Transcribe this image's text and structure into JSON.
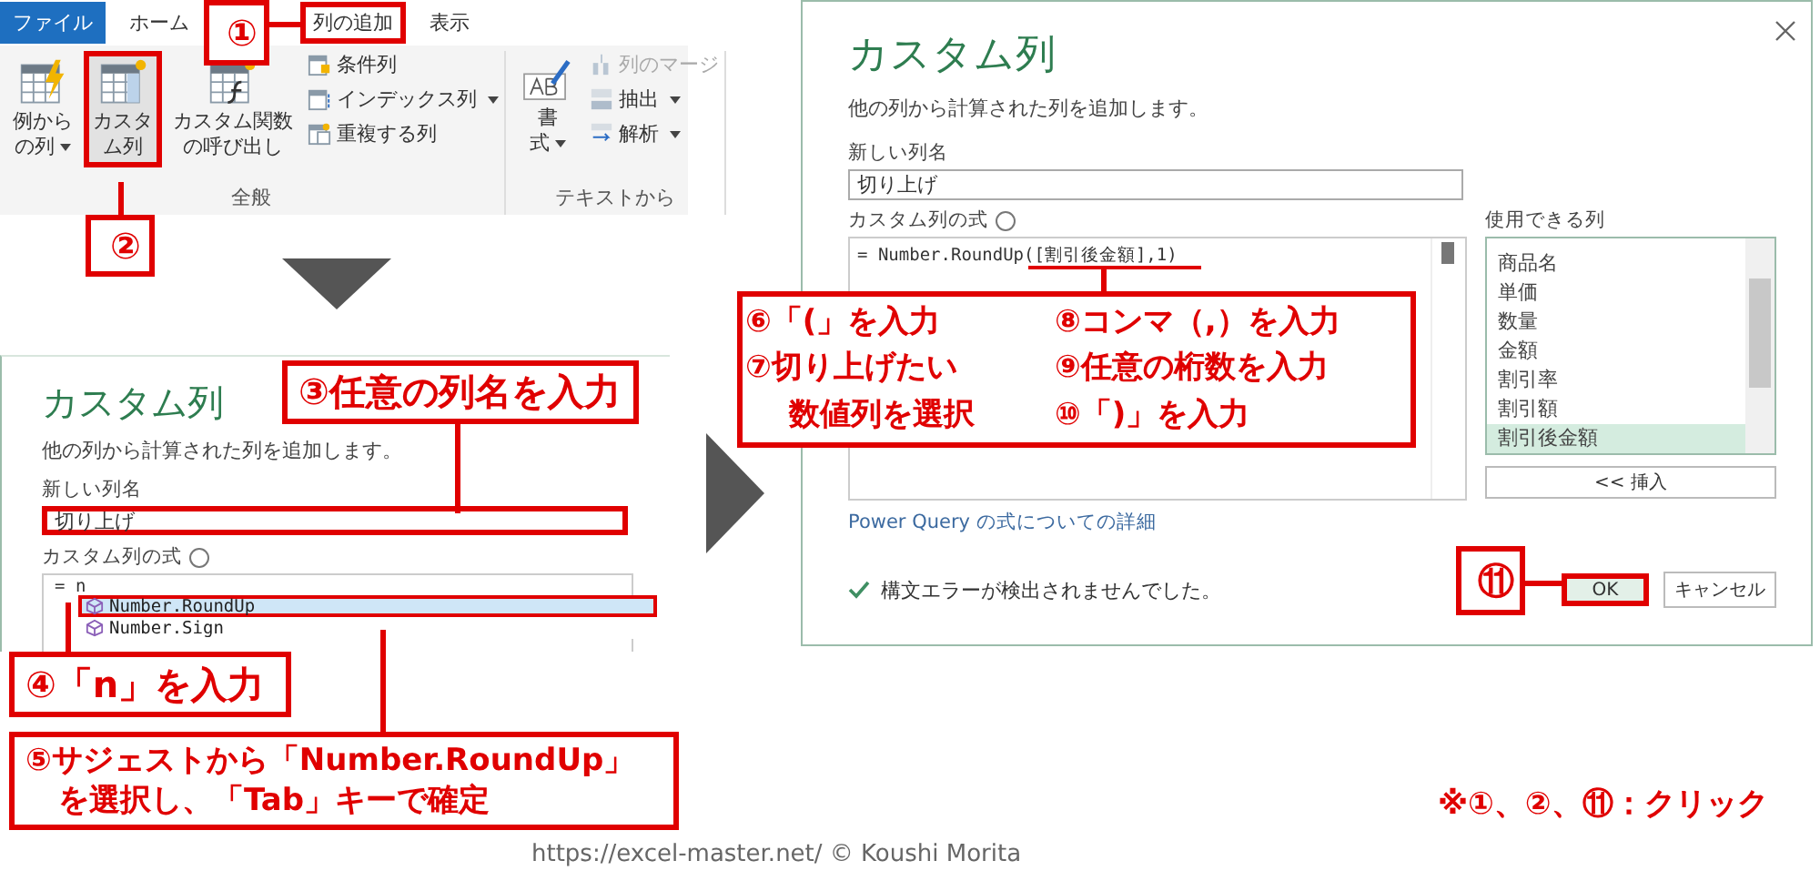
{
  "ribbon": {
    "tabs": [
      {
        "label": "ファイル",
        "kind": "file",
        "highlighted": false
      },
      {
        "label": "ホーム",
        "kind": "tab",
        "highlighted": false
      },
      {
        "label": "列の追加",
        "kind": "tab",
        "highlighted": true
      },
      {
        "label": "表示",
        "kind": "tab",
        "highlighted": false
      }
    ],
    "groups": [
      {
        "label": "全般",
        "large": [
          {
            "lines": [
              "例から",
              "の列"
            ],
            "dropdown": true,
            "highlighted": false
          },
          {
            "lines": [
              "カスタ",
              "ム列"
            ],
            "dropdown": false,
            "highlighted": true
          },
          {
            "lines": [
              "カスタム関数",
              "の呼び出し"
            ],
            "dropdown": false,
            "highlighted": false
          }
        ],
        "small": [
          {
            "label": "条件列",
            "dropdown": false,
            "disabled": false
          },
          {
            "label": "インデックス列",
            "dropdown": true,
            "disabled": false
          },
          {
            "label": "重複する列",
            "dropdown": false,
            "disabled": false
          }
        ]
      },
      {
        "label": "テキストから",
        "large": [
          {
            "lines": [
              "書",
              "式"
            ],
            "dropdown": true,
            "highlighted": false
          }
        ],
        "small": [
          {
            "label": "列のマージ",
            "dropdown": false,
            "disabled": true
          },
          {
            "label": "抽出",
            "dropdown": true,
            "disabled": false
          },
          {
            "label": "解析",
            "dropdown": true,
            "disabled": false
          }
        ]
      }
    ]
  },
  "dialog_1": {
    "title": "カスタム列",
    "description": "他の列から計算された列を追加します。",
    "name_label": "新しい列名",
    "name_value": "切り上げ",
    "name_highlighted": true,
    "formula_label": "カスタム列の式",
    "formula": "= n",
    "suggestions": [
      {
        "label": "Number.RoundUp",
        "selected": true
      },
      {
        "label": "Number.Sign",
        "selected": false
      }
    ]
  },
  "dialog_2": {
    "title": "カスタム列",
    "description": "他の列から計算された列を追加します。",
    "name_label": "新しい列名",
    "name_value": "切り上げ",
    "formula_label": "カスタム列の式",
    "formula": "= Number.RoundUp([割引後金額],1)",
    "available_label": "使用できる列",
    "columns": [
      {
        "label": "商品名",
        "selected": false
      },
      {
        "label": "単価",
        "selected": false
      },
      {
        "label": "数量",
        "selected": false
      },
      {
        "label": "金額",
        "selected": false
      },
      {
        "label": "割引率",
        "selected": false
      },
      {
        "label": "割引額",
        "selected": false
      },
      {
        "label": "割引後金額",
        "selected": true
      }
    ],
    "insert_button": "<< 挿入",
    "link": "Power Query の式についての詳細",
    "status": "構文エラーが検出されませんでした。",
    "ok_button": "OK",
    "ok_highlighted": true,
    "cancel_button": "キャンセル"
  },
  "callouts": [
    {
      "lines": [
        "①"
      ]
    },
    {
      "lines": [
        "②"
      ]
    },
    {
      "lines": [
        "③任意の列名を入力"
      ]
    },
    {
      "lines": [
        "④「n」を入力"
      ]
    },
    {
      "lines": [
        "⑤サジェストから「Number.RoundUp」",
        "を選択し、「Tab」キーで確定"
      ]
    },
    {
      "lines": [
        "⑥「(」を入力",
        "⑦切り上げたい",
        "数値列を選択",
        "⑧コンマ（,）を入力",
        "⑨任意の桁数を入力",
        "⑩「)」を入力"
      ]
    },
    {
      "lines": [
        "⑪"
      ]
    }
  ],
  "footnote": "※①、②、⑪：クリック",
  "credit": "https://excel-master.net/  © Koushi Morita"
}
